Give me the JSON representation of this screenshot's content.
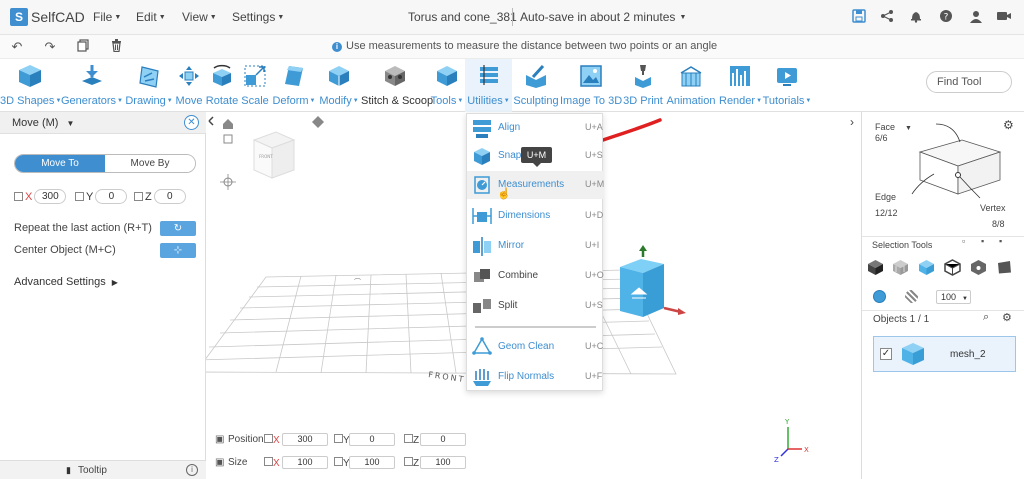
{
  "app": {
    "name": "SelfCAD"
  },
  "menus": [
    "File",
    "Edit",
    "View",
    "Settings"
  ],
  "document": {
    "title": "Torus and cone_381",
    "autosave": "Auto-save in about 2 minutes"
  },
  "hint": "Use measurements to measure the distance between two points or an angle",
  "toolbar": {
    "items": [
      {
        "label": "3D Shapes",
        "caret": true
      },
      {
        "label": "Generators",
        "caret": true
      },
      {
        "label": "Drawing",
        "caret": true
      },
      {
        "label": "Move",
        "caret": false
      },
      {
        "label": "Rotate",
        "caret": false
      },
      {
        "label": "Scale",
        "caret": false
      },
      {
        "label": "Deform",
        "caret": true
      },
      {
        "label": "Modify",
        "caret": true
      },
      {
        "label": "Stitch & Scoop",
        "caret": false
      },
      {
        "label": "Tools",
        "caret": true
      },
      {
        "label": "Utilities",
        "caret": true
      },
      {
        "label": "Sculpting",
        "caret": false
      },
      {
        "label": "Image To 3D",
        "caret": false
      },
      {
        "label": "3D Print",
        "caret": false
      },
      {
        "label": "Animation",
        "caret": false
      },
      {
        "label": "Render",
        "caret": true
      },
      {
        "label": "Tutorials",
        "caret": true
      }
    ],
    "find_placeholder": "Find Tool"
  },
  "left_panel": {
    "title": "Move (M)",
    "mode_on": "Move To",
    "mode_off": "Move By",
    "axes": [
      {
        "label": "X",
        "value": "300"
      },
      {
        "label": "Y",
        "value": "0"
      },
      {
        "label": "Z",
        "value": "0"
      }
    ],
    "repeat_label": "Repeat the last action (R+T)",
    "center_label": "Center Object (M+C)",
    "advanced": "Advanced Settings",
    "tooltip": "Tooltip"
  },
  "utilities_menu": {
    "items": [
      {
        "label": "Align",
        "shortcut": "U+A"
      },
      {
        "label": "Snap",
        "shortcut": "U+S"
      },
      {
        "label": "Measurements",
        "shortcut": "U+M"
      },
      {
        "label": "Dimensions",
        "shortcut": "U+D"
      },
      {
        "label": "Mirror",
        "shortcut": "U+I"
      },
      {
        "label": "Combine",
        "shortcut": "U+O"
      },
      {
        "label": "Split",
        "shortcut": "U+S"
      },
      {
        "label": "Geom Clean",
        "shortcut": "U+C"
      },
      {
        "label": "Flip Normals",
        "shortcut": "U+F"
      }
    ],
    "tooltip": "U+M"
  },
  "viewport": {
    "front_label": "FRONT",
    "cube_label": "FRONT"
  },
  "bottom": {
    "position_label": "Position",
    "size_label": "Size",
    "position": {
      "x": "300",
      "y": "0",
      "z": "0"
    },
    "size": {
      "x": "100",
      "y": "100",
      "z": "100"
    },
    "axis_labels": [
      "X",
      "Y",
      "Z"
    ]
  },
  "right_panel": {
    "face_label": "Face",
    "face_count": "6/6",
    "edge_label": "Edge",
    "edge_count": "12/12",
    "vertex_label": "Vertex",
    "vertex_count": "8/8",
    "selection_tools": "Selection Tools",
    "opacity": "100",
    "objects_label": "Objects 1 / 1",
    "object_name": "mesh_2"
  },
  "colors": {
    "accent": "#3e8ed0",
    "cube": "#4fb3e8",
    "annotation": "#e02020"
  }
}
